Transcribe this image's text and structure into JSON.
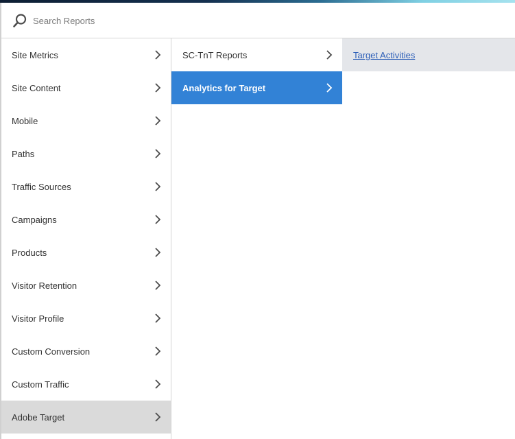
{
  "search": {
    "placeholder": "Search Reports",
    "value": ""
  },
  "column1": {
    "items": [
      {
        "label": "Site Metrics"
      },
      {
        "label": "Site Content"
      },
      {
        "label": "Mobile"
      },
      {
        "label": "Paths"
      },
      {
        "label": "Traffic Sources"
      },
      {
        "label": "Campaigns"
      },
      {
        "label": "Products"
      },
      {
        "label": "Visitor Retention"
      },
      {
        "label": "Visitor Profile"
      },
      {
        "label": "Custom Conversion"
      },
      {
        "label": "Custom Traffic"
      },
      {
        "label": "Adobe Target"
      }
    ],
    "selected_index": 11
  },
  "column2": {
    "items": [
      {
        "label": "SC-TnT Reports"
      },
      {
        "label": "Analytics for Target"
      }
    ],
    "selected_index": 1
  },
  "column3": {
    "items": [
      {
        "label": "Target Activities"
      }
    ]
  },
  "colors": {
    "accent_blue": "#3282d6",
    "selected_grey": "#dadada",
    "link_blue": "#2d5fb8"
  },
  "icons": {
    "search": "search-icon",
    "chevron": "chevron-right-icon"
  }
}
